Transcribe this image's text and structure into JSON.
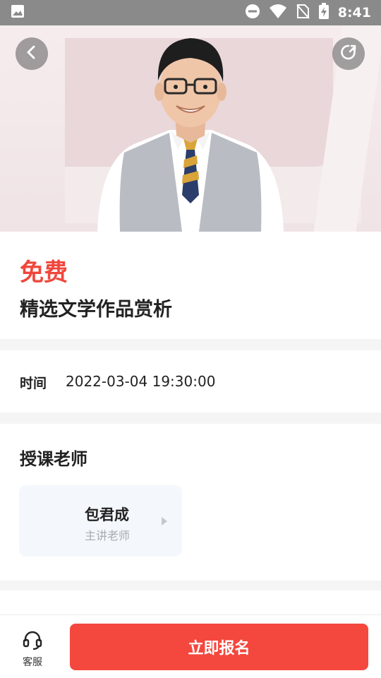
{
  "status_bar": {
    "time": "8:41",
    "icons": [
      "image-icon",
      "dnd-icon",
      "wifi-icon",
      "no-sim-icon",
      "battery-charging-icon"
    ]
  },
  "hero": {
    "back_icon": "chevron-left-icon",
    "share_icon": "share-icon"
  },
  "course": {
    "price": "免费",
    "title": "精选文学作品赏析"
  },
  "schedule": {
    "label": "时间",
    "value": "2022-03-04 19:30:00"
  },
  "teachers": {
    "section_title": "授课老师",
    "items": [
      {
        "name": "包君成",
        "role": "主讲老师"
      }
    ]
  },
  "bottom_bar": {
    "service_label": "客服",
    "service_icon": "headset-icon",
    "signup_label": "立即报名"
  },
  "colors": {
    "accent": "#f4473d",
    "price": "#f0473c",
    "status_bar": "#8a8a8a"
  }
}
